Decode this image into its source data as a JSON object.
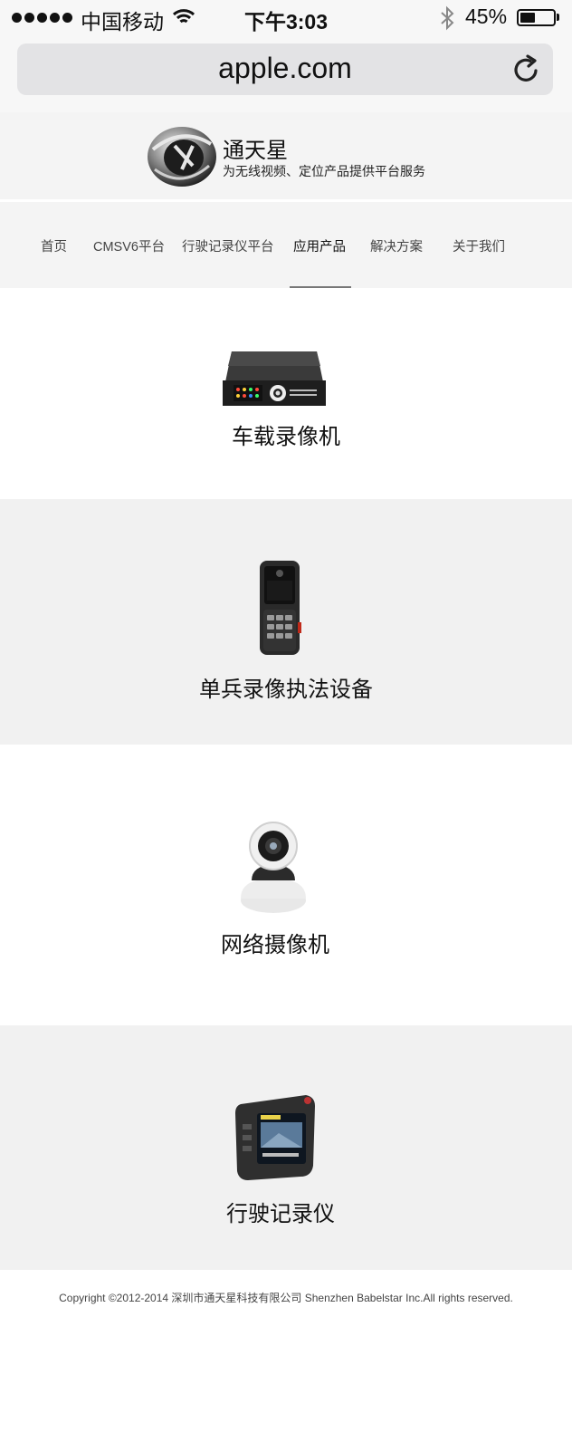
{
  "status_bar": {
    "carrier": "中国移动",
    "time": "下午3:03",
    "battery_percent_text": "45%",
    "battery_level": 0.45
  },
  "browser": {
    "url": "apple.com",
    "reload_icon": "reload-icon"
  },
  "site": {
    "brand_name": "通天星",
    "tagline": "为无线视频、定位产品提供平台服务",
    "logo_icon": "brand-logo-icon"
  },
  "nav": {
    "items": [
      {
        "label": "首页"
      },
      {
        "label": "CMSV6平台"
      },
      {
        "label": "行驶记录仪平台"
      },
      {
        "label": "应用产品"
      },
      {
        "label": "解决方案"
      },
      {
        "label": "关于我们"
      }
    ],
    "active": "应用产品"
  },
  "products": [
    {
      "title": "车载录像机",
      "icon": "vehicle-dvr-icon"
    },
    {
      "title": "单兵录像执法设备",
      "icon": "body-camera-icon"
    },
    {
      "title": "网络摄像机",
      "icon": "ip-camera-icon"
    },
    {
      "title": "行驶记录仪",
      "icon": "dashcam-icon"
    }
  ],
  "footer": {
    "copyright": "Copyright ©2012-2014 深圳市通天星科技有限公司  Shenzhen Babelstar Inc.All rights reserved."
  },
  "colors": {
    "page_bg": "#ffffff",
    "section_gray": "#f1f1f1",
    "nav_bg": "#f4f4f4",
    "url_bar_bg": "#e3e3e5"
  }
}
